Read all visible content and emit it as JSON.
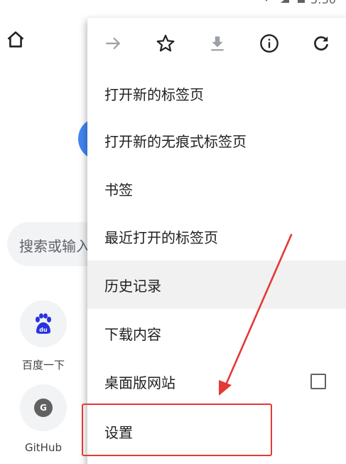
{
  "status_bar": {
    "time": "5:30"
  },
  "page": {
    "search_placeholder": "搜索或输入",
    "shortcuts": [
      {
        "label": "百度一下",
        "icon": "baidu-paw-icon"
      },
      {
        "label": "GitHub",
        "icon": "github-letter-icon",
        "letter": "G"
      }
    ]
  },
  "menu": {
    "toolbar": [
      {
        "name": "forward-icon",
        "disabled": true
      },
      {
        "name": "star-icon"
      },
      {
        "name": "download-icon",
        "disabled": true
      },
      {
        "name": "info-icon"
      },
      {
        "name": "reload-icon"
      }
    ],
    "items": [
      {
        "label": "打开新的标签页"
      },
      {
        "label": "打开新的无痕式标签页"
      },
      {
        "label": "书签"
      },
      {
        "label": "最近打开的标签页"
      },
      {
        "label": "历史记录",
        "highlighted": true
      },
      {
        "label": "下载内容"
      },
      {
        "label": "桌面版网站",
        "checkbox": false
      },
      {
        "label": "设置",
        "annotated": true
      }
    ]
  },
  "colors": {
    "annotation": "#e53935",
    "menu_highlight": "#f1f1f1",
    "disabled_icon": "#9aa0a6",
    "icon": "#202124",
    "baidu_blue": "#2932e1"
  }
}
